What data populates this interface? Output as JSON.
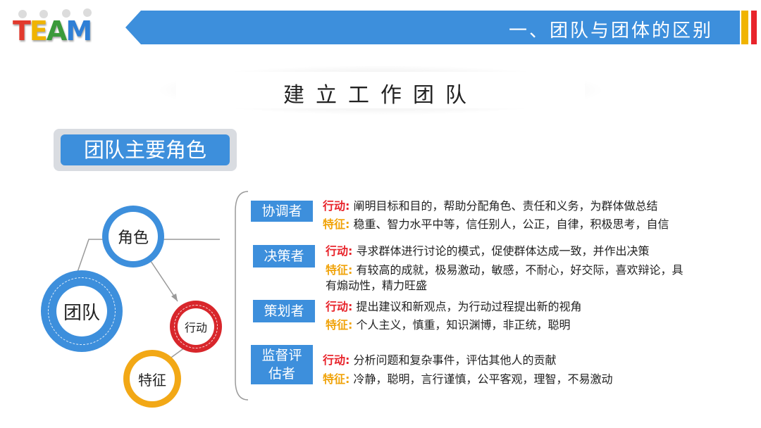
{
  "logo": {
    "letters": [
      "T",
      "E",
      "A",
      "M"
    ],
    "colors": [
      "#e23a2e",
      "#f0b400",
      "#3a9a3a",
      "#2e7fd6"
    ]
  },
  "header": {
    "title": "一、团队与团体的区别",
    "banner_color": "#3d8fdc",
    "accent_bars": [
      "#f0b400",
      "#e8242b"
    ]
  },
  "page_title": "建立工作团队",
  "section_label": "团队主要角色",
  "diagram": {
    "team": "团队",
    "role": "角色",
    "action": "行动",
    "trait": "特征"
  },
  "roles": [
    {
      "name": "协调者",
      "action_key": "行动:",
      "action": "阐明目标和目的，帮助分配角色、责任和义务，为群体做总结",
      "trait_key": "特征:",
      "trait": "稳重、智力水平中等，信任别人，公正，自律，积极思考，自信"
    },
    {
      "name": "决策者",
      "action_key": "行动:",
      "action": "寻求群体进行讨论的模式，促使群体达成一致，并作出决策",
      "trait_key": "特征:",
      "trait": "有较高的成就，极易激动，敏感，不耐心，好交际，喜欢辩论，具",
      "trait_cont": "有煽动性，精力旺盛"
    },
    {
      "name": "策划者",
      "action_key": "行动:",
      "action": "提出建议和新观点，为行动过程提出新的视角",
      "trait_key": "特征:",
      "trait": "个人主义，慎重，知识渊博，非正统，聪明"
    },
    {
      "name_line1": "监督评",
      "name_line2": "估者",
      "action_key": "行动:",
      "action": "分析问题和复杂事件，评估其他人的贡献",
      "trait_key": "特征:",
      "trait": "冷静，聪明，言行谨慎，公平客观，理智，不易激动"
    }
  ],
  "colors": {
    "blue": "#3d8fdc",
    "red": "#d8262b",
    "orange": "#f2a816",
    "key_red": "#e8242b",
    "key_orange": "#f0a30a"
  }
}
